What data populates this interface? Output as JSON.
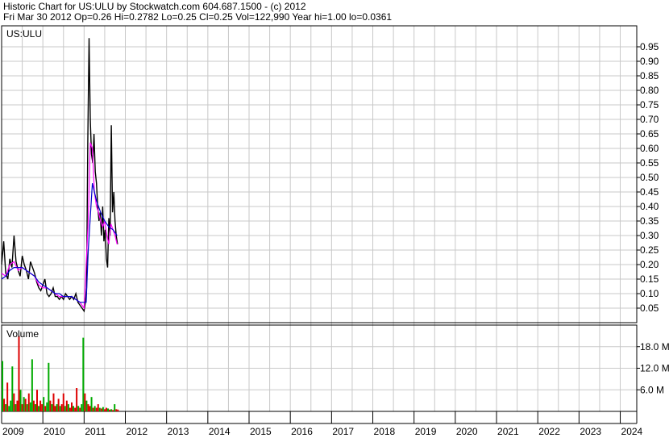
{
  "header": {
    "line1": "Historic Chart for US:ULU by Stockwatch.com 604.687.1500 - (c) 2012",
    "line2": "Fri Mar 30 2012  Op=0.26  Hi=0.2782  Lo=0.25  Cl=0.25  Vol=122,990  Year hi=1.00  lo=0.0361"
  },
  "chart_data": {
    "type": "line",
    "symbol_label": "US:ULU",
    "volume_label": "Volume",
    "price_axis": {
      "range": [
        0,
        1.0
      ],
      "ticks": [
        "0.05",
        "0.10",
        "0.15",
        "0.20",
        "0.25",
        "0.30",
        "0.35",
        "0.40",
        "0.45",
        "0.50",
        "0.55",
        "0.60",
        "0.65",
        "0.70",
        "0.75",
        "0.80",
        "0.85",
        "0.90",
        "0.95"
      ]
    },
    "volume_axis": {
      "range": [
        0,
        24
      ],
      "unit": "M",
      "ticks": [
        "6.0 M",
        "12.0 M",
        "18.0 M"
      ]
    },
    "x_axis": {
      "range": [
        2009.0,
        2024.4
      ],
      "ticks": [
        "2009",
        "2010",
        "2011",
        "2012",
        "2013",
        "2014",
        "2015",
        "2016",
        "2017",
        "2018",
        "2019",
        "2020",
        "2021",
        "2022",
        "2023",
        "2024"
      ]
    },
    "series": [
      {
        "color": "#000000",
        "x": [
          2009.0,
          2009.05,
          2009.1,
          2009.15,
          2009.2,
          2009.25,
          2009.3,
          2009.35,
          2009.4,
          2009.45,
          2009.5,
          2009.55,
          2009.6,
          2009.65,
          2009.7,
          2009.75,
          2009.8,
          2009.85,
          2009.9,
          2009.95,
          2010.0,
          2010.05,
          2010.1,
          2010.15,
          2010.2,
          2010.25,
          2010.3,
          2010.35,
          2010.4,
          2010.45,
          2010.5,
          2010.55,
          2010.6,
          2010.65,
          2010.7,
          2010.75,
          2010.8,
          2010.85,
          2010.9,
          2010.95,
          2011.0,
          2011.03,
          2011.06,
          2011.09,
          2011.12,
          2011.15,
          2011.18,
          2011.21,
          2011.24,
          2011.27,
          2011.3,
          2011.33,
          2011.36,
          2011.39,
          2011.42,
          2011.45,
          2011.48,
          2011.51,
          2011.54,
          2011.57,
          2011.6,
          2011.63,
          2011.66,
          2011.69,
          2011.72,
          2011.75,
          2011.78,
          2011.81
        ],
        "y": [
          0.2,
          0.28,
          0.17,
          0.15,
          0.22,
          0.19,
          0.3,
          0.21,
          0.18,
          0.16,
          0.23,
          0.2,
          0.18,
          0.15,
          0.21,
          0.19,
          0.17,
          0.14,
          0.12,
          0.11,
          0.13,
          0.15,
          0.1,
          0.09,
          0.1,
          0.12,
          0.09,
          0.09,
          0.08,
          0.09,
          0.08,
          0.1,
          0.09,
          0.08,
          0.09,
          0.08,
          0.1,
          0.07,
          0.06,
          0.05,
          0.04,
          0.07,
          0.12,
          0.62,
          0.98,
          0.7,
          0.58,
          0.55,
          0.65,
          0.52,
          0.48,
          0.4,
          0.35,
          0.38,
          0.3,
          0.4,
          0.28,
          0.32,
          0.22,
          0.19,
          0.36,
          0.3,
          0.68,
          0.38,
          0.45,
          0.35,
          0.3,
          0.27
        ]
      },
      {
        "color": "#ff00ff",
        "x": [
          2009.0,
          2009.1,
          2009.2,
          2009.3,
          2009.4,
          2009.5,
          2009.6,
          2009.7,
          2009.8,
          2009.9,
          2010.0,
          2010.1,
          2010.2,
          2010.3,
          2010.4,
          2010.5,
          2010.6,
          2010.7,
          2010.8,
          2010.9,
          2011.0,
          2011.1,
          2011.15,
          2011.2,
          2011.25,
          2011.3,
          2011.35,
          2011.4,
          2011.45,
          2011.5,
          2011.55,
          2011.6,
          2011.65,
          2011.7,
          2011.75,
          2011.8
        ],
        "y": [
          0.17,
          0.16,
          0.2,
          0.21,
          0.18,
          0.19,
          0.18,
          0.17,
          0.16,
          0.13,
          0.12,
          0.12,
          0.11,
          0.1,
          0.09,
          0.09,
          0.09,
          0.09,
          0.08,
          0.07,
          0.05,
          0.35,
          0.62,
          0.6,
          0.45,
          0.4,
          0.38,
          0.35,
          0.33,
          0.35,
          0.3,
          0.27,
          0.34,
          0.32,
          0.3,
          0.27
        ]
      },
      {
        "color": "#0000cc",
        "x": [
          2009.0,
          2009.1,
          2009.2,
          2009.3,
          2009.4,
          2009.5,
          2009.6,
          2009.7,
          2009.8,
          2009.9,
          2010.0,
          2010.1,
          2010.2,
          2010.3,
          2010.4,
          2010.5,
          2010.6,
          2010.7,
          2010.8,
          2010.9,
          2011.0,
          2011.05,
          2011.1,
          2011.2,
          2011.3,
          2011.4,
          2011.5,
          2011.6,
          2011.7,
          2011.8
        ],
        "y": [
          0.15,
          0.16,
          0.18,
          0.19,
          0.19,
          0.19,
          0.18,
          0.17,
          0.16,
          0.14,
          0.13,
          0.12,
          0.11,
          0.1,
          0.1,
          0.09,
          0.09,
          0.09,
          0.08,
          0.07,
          0.07,
          0.07,
          0.25,
          0.48,
          0.42,
          0.38,
          0.35,
          0.33,
          0.32,
          0.3
        ]
      }
    ],
    "volume": {
      "x": [
        2009.02,
        2009.06,
        2009.1,
        2009.14,
        2009.18,
        2009.22,
        2009.26,
        2009.3,
        2009.34,
        2009.38,
        2009.42,
        2009.46,
        2009.5,
        2009.54,
        2009.58,
        2009.62,
        2009.66,
        2009.7,
        2009.74,
        2009.78,
        2009.82,
        2009.86,
        2009.9,
        2009.94,
        2009.98,
        2010.02,
        2010.06,
        2010.1,
        2010.14,
        2010.18,
        2010.22,
        2010.26,
        2010.3,
        2010.34,
        2010.38,
        2010.42,
        2010.46,
        2010.5,
        2010.54,
        2010.58,
        2010.62,
        2010.66,
        2010.7,
        2010.74,
        2010.78,
        2010.82,
        2010.86,
        2010.9,
        2010.94,
        2010.98,
        2011.02,
        2011.06,
        2011.1,
        2011.14,
        2011.18,
        2011.22,
        2011.26,
        2011.3,
        2011.34,
        2011.38,
        2011.42,
        2011.46,
        2011.5,
        2011.54,
        2011.58,
        2011.62,
        2011.66,
        2011.7,
        2011.74,
        2011.78,
        2011.82
      ],
      "values": [
        14.0,
        3.5,
        2.0,
        8.0,
        1.5,
        3.0,
        12.5,
        5.0,
        2.0,
        3.0,
        21.0,
        6.0,
        2.0,
        4.0,
        3.5,
        2.0,
        5.0,
        2.5,
        14.5,
        3.0,
        2.0,
        6.0,
        1.5,
        3.0,
        2.0,
        4.0,
        1.5,
        2.5,
        13.5,
        3.0,
        2.0,
        5.0,
        1.5,
        2.0,
        3.5,
        1.5,
        2.0,
        5.0,
        1.5,
        3.0,
        2.0,
        1.0,
        2.5,
        1.5,
        1.0,
        6.5,
        1.5,
        1.0,
        2.0,
        20.5,
        5.0,
        3.0,
        2.0,
        1.5,
        4.0,
        1.0,
        1.5,
        1.0,
        2.0,
        1.0,
        0.8,
        1.2,
        0.6,
        1.0,
        0.8,
        0.5,
        0.6,
        0.4,
        2.0,
        0.6,
        0.5
      ],
      "up": [
        true,
        false,
        true,
        false,
        true,
        true,
        true,
        false,
        true,
        false,
        false,
        true,
        false,
        true,
        false,
        true,
        false,
        true,
        true,
        false,
        true,
        false,
        true,
        false,
        false,
        true,
        false,
        true,
        true,
        false,
        true,
        false,
        false,
        true,
        false,
        true,
        false,
        false,
        true,
        false,
        true,
        false,
        false,
        true,
        false,
        false,
        true,
        false,
        true,
        true,
        false,
        true,
        false,
        false,
        true,
        false,
        true,
        false,
        false,
        true,
        false,
        true,
        false,
        false,
        true,
        false,
        true,
        false,
        true,
        false,
        false
      ]
    },
    "colors": {
      "up_volume": "#00aa00",
      "down_volume": "#dd0000",
      "grid": "#c8c8c8",
      "frame": "#000000"
    }
  }
}
